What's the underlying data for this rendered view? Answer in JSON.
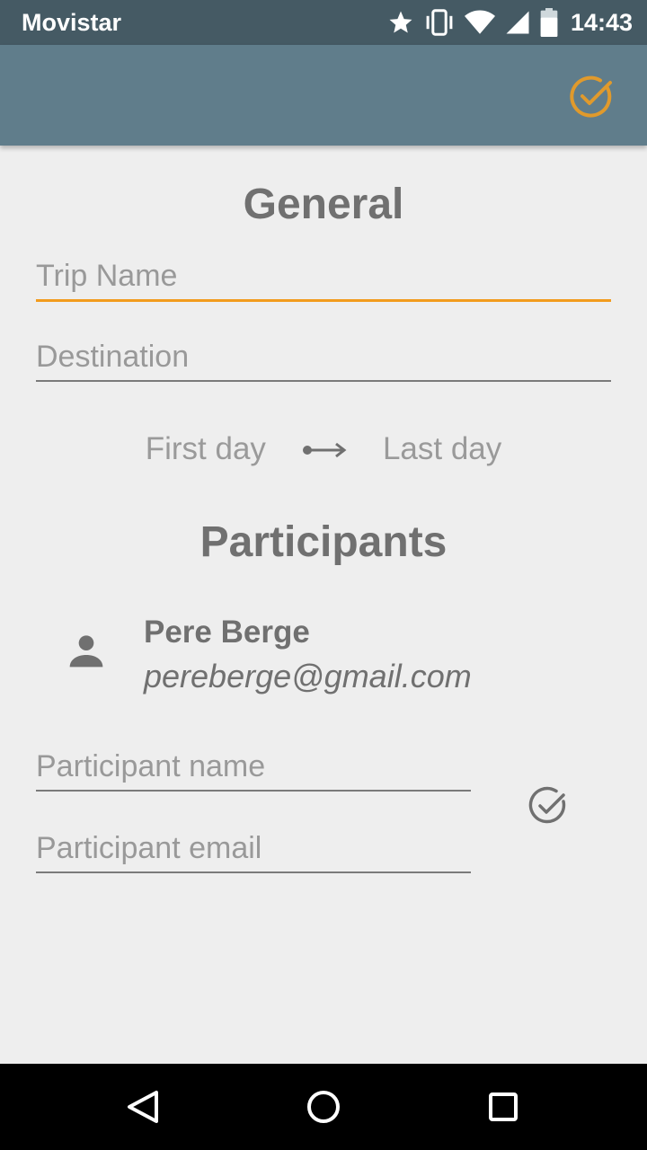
{
  "status_bar": {
    "carrier": "Movistar",
    "time": "14:43",
    "icons": [
      "star-icon",
      "vibrate-icon",
      "wifi-icon",
      "cell-signal-icon",
      "battery-icon"
    ]
  },
  "app_bar": {
    "confirm_icon": "check-circle-icon",
    "accent_color": "#f29b1d"
  },
  "general": {
    "title": "General",
    "trip_name_placeholder": "Trip Name",
    "trip_name_value": "",
    "destination_placeholder": "Destination",
    "destination_value": "",
    "first_day": "First day",
    "last_day": "Last day"
  },
  "participants": {
    "title": "Participants",
    "list": [
      {
        "name": "Pere Berge",
        "email": "pereberge@gmail.com"
      }
    ],
    "name_placeholder": "Participant name",
    "email_placeholder": "Participant email"
  },
  "colors": {
    "status_bar": "#455a64",
    "app_bar": "#607d8b",
    "background": "#eeeeee",
    "focus_underline": "#f29b1d"
  }
}
